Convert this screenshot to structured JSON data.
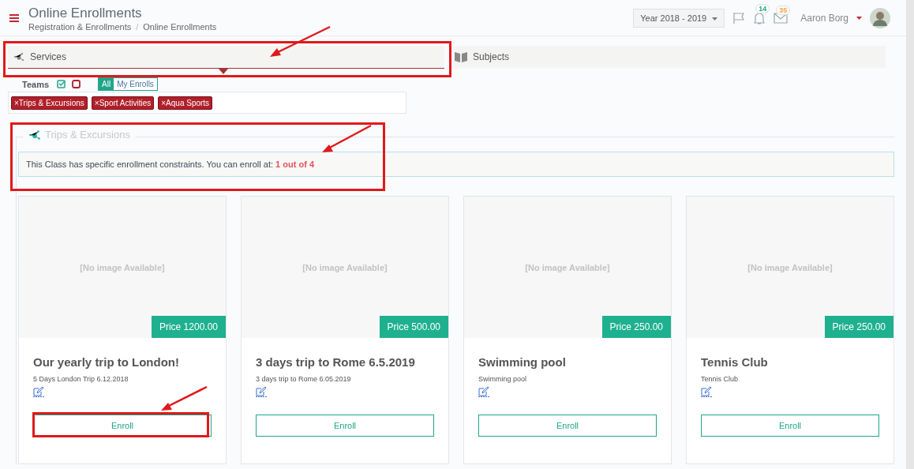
{
  "header": {
    "title": "Online Enrollments",
    "breadcrumb": [
      "Registration & Enrollments",
      "Online Enrollments"
    ],
    "separator": "/",
    "year": "Year 2018 - 2019",
    "notifications": "14",
    "messages": "35",
    "user": "Aaron Borg"
  },
  "tabs": [
    {
      "label": "Services",
      "selected": true,
      "annotated": true
    },
    {
      "label": "Subjects",
      "selected": false,
      "annotated": false
    }
  ],
  "filters": {
    "label": "Teams",
    "check_all": true,
    "uncheck_all": false,
    "toggle": [
      {
        "label": "All",
        "selected": true
      },
      {
        "label": "My Enrolls",
        "selected": false
      }
    ],
    "tags": [
      "×Trips & Excursions",
      "×Sport Activities",
      "×Aqua Sports"
    ]
  },
  "section": {
    "title": "Trips & Excursions",
    "notice": "This Class has specific enrollment constraints. You can enroll at: ",
    "limit": "1 out of 4",
    "annotated": true
  },
  "cards": [
    {
      "image": "[No image Available]",
      "price": "Price 1200.00",
      "title": "Our yearly trip to London!",
      "subtitle": "5 Days London Trip 6.12.2018",
      "button": "Enroll",
      "annotated": true
    },
    {
      "image": "[No image Available]",
      "price": "Price 500.00",
      "title": "3 days trip to Rome 6.5.2019",
      "subtitle": "3 days trip to Rome 6.05.2019",
      "button": "Enroll",
      "annotated": false
    },
    {
      "image": "[No image Available]",
      "price": "Price 250.00",
      "title": "Swimming pool",
      "subtitle": "Swimming pool",
      "button": "Enroll",
      "annotated": false
    },
    {
      "image": "[No image Available]",
      "price": "Price 250.00",
      "title": "Tennis Club",
      "subtitle": "Tennis Club",
      "button": "Enroll",
      "annotated": false
    }
  ]
}
